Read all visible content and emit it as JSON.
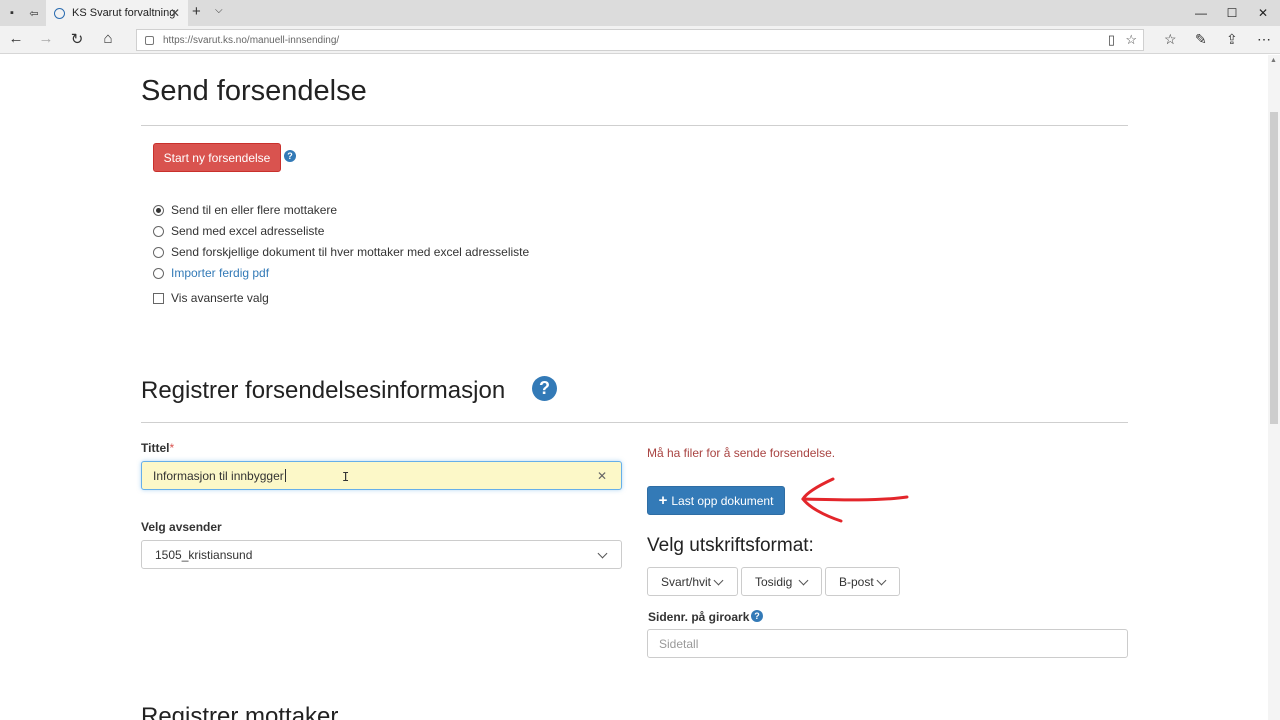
{
  "browser": {
    "tab_title": "KS Svarut forvaltning",
    "url": "https://svarut.ks.no/manuell-innsending/"
  },
  "header": {
    "title": "Send forsendelse",
    "start_button": "Start ny forsendelse"
  },
  "send_options": {
    "items": [
      {
        "label": "Send til en eller flere mottakere",
        "selected": true
      },
      {
        "label": "Send med excel adresseliste",
        "selected": false
      },
      {
        "label": "Send forskjellige dokument til hver mottaker med excel adresseliste",
        "selected": false
      },
      {
        "label": "Importer ferdig pdf",
        "selected": false
      }
    ],
    "advanced_checkbox": "Vis avanserte valg"
  },
  "registration": {
    "title": "Registrer forsendelsesinformasjon",
    "title_label": "Tittel",
    "required_mark": "*",
    "title_value": "Informasjon til innbygger",
    "sender_label": "Velg avsender",
    "sender_value": "1505_kristiansund",
    "error_message": "Må ha filer for å sende forsendelse.",
    "upload_button": "Last opp dokument",
    "format_title": "Velg utskriftsformat:",
    "format_options": [
      "Svart/hvit",
      "Tosidig",
      "B-post"
    ],
    "page_label": "Sidenr. på giroark",
    "page_placeholder": "Sidetall"
  },
  "next_section": {
    "title": "Registrer mottaker"
  },
  "colors": {
    "danger": "#d9534f",
    "primary": "#337ab7",
    "error_text": "#a94442",
    "annotation_arrow": "#e3262b"
  }
}
